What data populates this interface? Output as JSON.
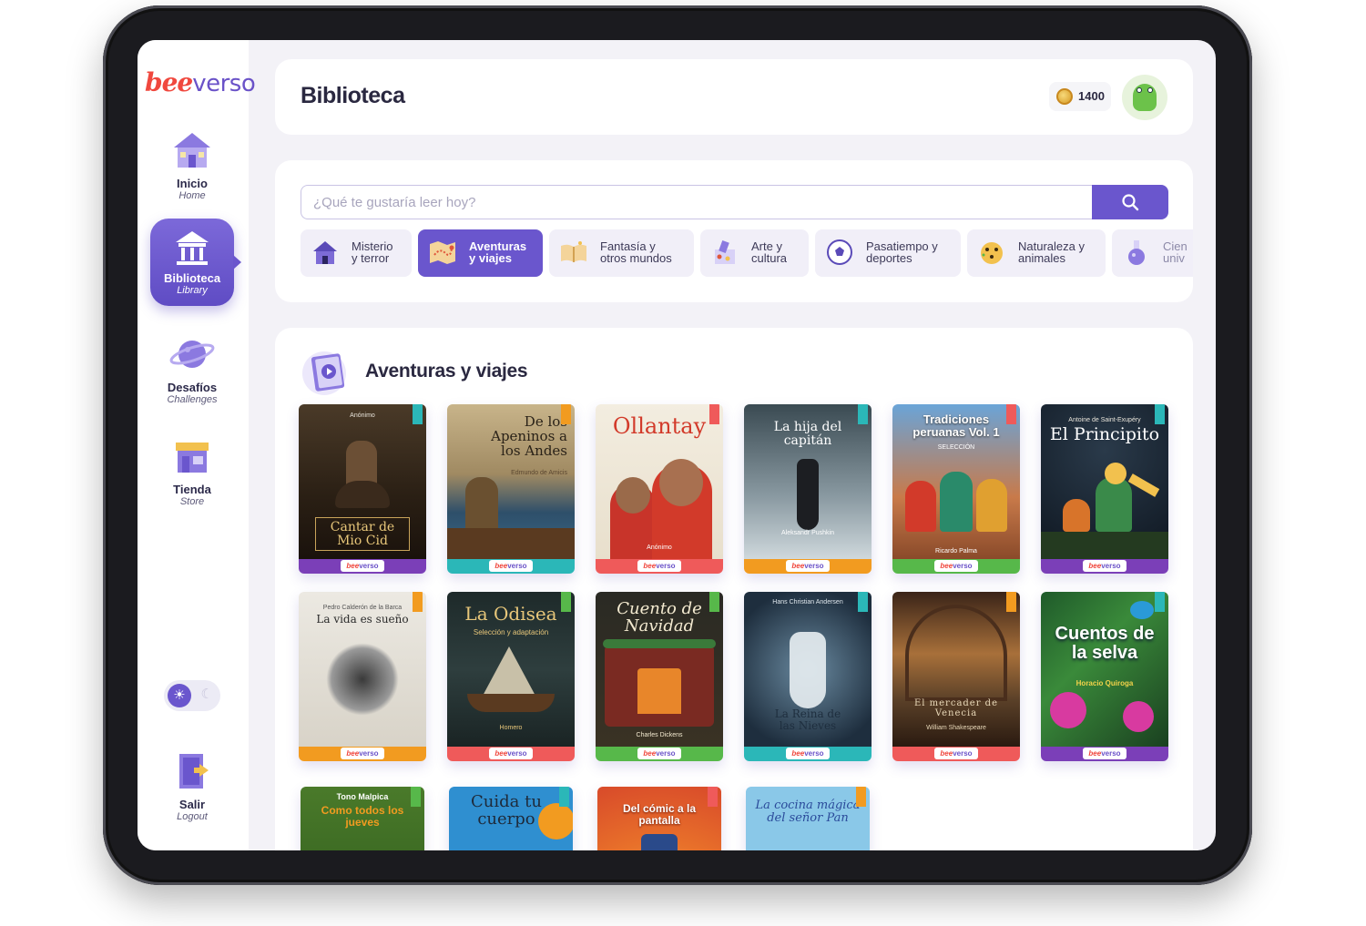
{
  "app": {
    "logo_part1": "bee",
    "logo_part2": "verso"
  },
  "sidebar": {
    "items": [
      {
        "label": "Inicio",
        "sub": "Home"
      },
      {
        "label": "Biblioteca",
        "sub": "Library"
      },
      {
        "label": "Desafíos",
        "sub": "Challenges"
      },
      {
        "label": "Tienda",
        "sub": "Store"
      },
      {
        "label": "Salir",
        "sub": "Logout"
      }
    ],
    "theme_toggle": {
      "state": "light"
    }
  },
  "header": {
    "title": "Biblioteca",
    "coins": "1400"
  },
  "search": {
    "placeholder": "¿Qué te gustaría leer hoy?",
    "value": ""
  },
  "categories": [
    {
      "line1": "Misterio",
      "line2": "y terror",
      "active": false
    },
    {
      "line1": "Aventuras",
      "line2": "y viajes",
      "active": true
    },
    {
      "line1": "Fantasía y",
      "line2": "otros mundos",
      "active": false
    },
    {
      "line1": "Arte y",
      "line2": "cultura",
      "active": false
    },
    {
      "line1": "Pasatiempo y",
      "line2": "deportes",
      "active": false
    },
    {
      "line1": "Naturaleza y",
      "line2": "animales",
      "active": false
    },
    {
      "line1": "Cien",
      "line2": "univ",
      "active": false
    }
  ],
  "section": {
    "title": "Aventuras y viajes"
  },
  "books": [
    {
      "title": "Cantar de Mio Cid",
      "author": "Anónimo",
      "band": "#7b3fb8"
    },
    {
      "title": "De los Apeninos a los Andes",
      "author": "Edmundo de Amicis",
      "band": "#2bb7b8"
    },
    {
      "title": "Ollantay",
      "author": "Anónimo",
      "band": "#ef5a5a"
    },
    {
      "title": "La hija del capitán",
      "author": "Aleksandr Pushkin",
      "band": "#f29b20"
    },
    {
      "title": "Tradiciones peruanas Vol. 1",
      "subtitle": "SELECCIÓN",
      "author": "Ricardo Palma",
      "band": "#57b84a"
    },
    {
      "title": "El Principito",
      "author": "Antoine de Saint-Exupéry",
      "band": "#7b3fb8"
    },
    {
      "title": "La vida es sueño",
      "author": "Pedro Calderón de la Barca",
      "band": "#f29b20"
    },
    {
      "title": "La Odisea",
      "subtitle": "Selección y adaptación",
      "author": "Homero",
      "band": "#ef5a5a"
    },
    {
      "title": "Cuento de Navidad",
      "author": "Charles Dickens",
      "band": "#57b84a"
    },
    {
      "title": "La Reina de las Nieves",
      "author": "Hans Christian Andersen",
      "band": "#2bb7b8"
    },
    {
      "title": "El mercader de Venecia",
      "author": "William Shakespeare",
      "band": "#ef5a5a"
    },
    {
      "title": "Cuentos de la selva",
      "author": "Horacio Quiroga",
      "band": "#7b3fb8"
    },
    {
      "title": "Como todos los jueves",
      "author": "Tono Malpica",
      "band": "#57b84a"
    },
    {
      "title": "Cuida tu cuerpo",
      "author": "",
      "band": "#2bb7b8"
    },
    {
      "title": "Del cómic a la pantalla",
      "author": "",
      "band": "#ef5a5a"
    },
    {
      "title": "La cocina mágica del señor Pan",
      "author": "",
      "band": "#f29b20"
    }
  ],
  "colors": {
    "accent": "#6a56cd",
    "bg": "#f3f2f7",
    "text": "#2a2840"
  }
}
